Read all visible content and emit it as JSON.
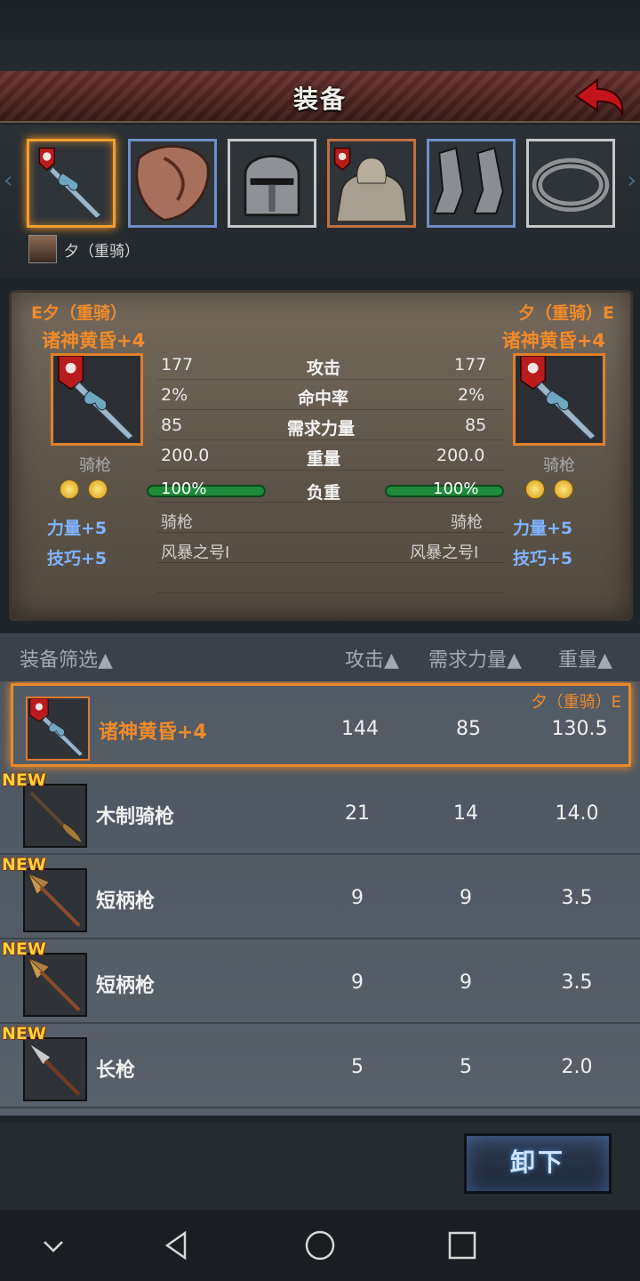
{
  "header": {
    "title": "装备"
  },
  "hero": {
    "name": "夕（重骑）"
  },
  "equip_slots": [
    {
      "icon": "lance-icon",
      "selected": true
    },
    {
      "icon": "shield-icon",
      "selected": false
    },
    {
      "icon": "helmet-icon",
      "selected": false
    },
    {
      "icon": "armor-icon",
      "selected": false
    },
    {
      "icon": "greaves-icon",
      "selected": false
    },
    {
      "icon": "ring-icon",
      "selected": false
    }
  ],
  "compare": {
    "left": {
      "owner": "E夕（重骑）",
      "item_name": "诸神黄昏+4",
      "type": "骑枪",
      "attr1": "力量+5",
      "attr2": "技巧+5",
      "attack": "177",
      "hit": "2%",
      "str_req": "85",
      "weight": "200.0",
      "load_pct": "100%",
      "load": 1.0,
      "spec_type": "骑枪",
      "skill": "风暴之号I"
    },
    "right": {
      "owner": "夕（重骑）E",
      "item_name": "诸神黄昏+4",
      "type": "骑枪",
      "attr1": "力量+5",
      "attr2": "技巧+5",
      "attack": "177",
      "hit": "2%",
      "str_req": "85",
      "weight": "200.0",
      "load_pct": "100%",
      "load": 1.0,
      "spec_type": "骑枪",
      "skill": "风暴之号I"
    },
    "labels": {
      "attack": "攻击",
      "hit": "命中率",
      "str_req": "需求力量",
      "weight": "重量",
      "load": "负重"
    }
  },
  "list_head": {
    "filter": "装备筛选▲",
    "attack": "攻击▲",
    "str_req": "需求力量▲",
    "weight": "重量▲"
  },
  "items": [
    {
      "name": "诸神黄昏+4",
      "attack": "144",
      "str_req": "85",
      "weight": "130.5",
      "owner": "夕（重骑）E",
      "is_new": false,
      "selected": true
    },
    {
      "name": "木制骑枪",
      "attack": "21",
      "str_req": "14",
      "weight": "14.0",
      "badge": "NEW",
      "is_new": true
    },
    {
      "name": "短柄枪",
      "attack": "9",
      "str_req": "9",
      "weight": "3.5",
      "badge": "NEW",
      "is_new": true
    },
    {
      "name": "短柄枪",
      "attack": "9",
      "str_req": "9",
      "weight": "3.5",
      "badge": "NEW",
      "is_new": true
    },
    {
      "name": "长枪",
      "attack": "5",
      "str_req": "5",
      "weight": "2.0",
      "badge": "NEW",
      "is_new": true
    }
  ],
  "footer": {
    "unequip_label": "卸下"
  },
  "colors": {
    "accent_orange": "#f08a2a",
    "attr_blue": "#7fb4ff",
    "load_green": "#1f8a3a"
  }
}
